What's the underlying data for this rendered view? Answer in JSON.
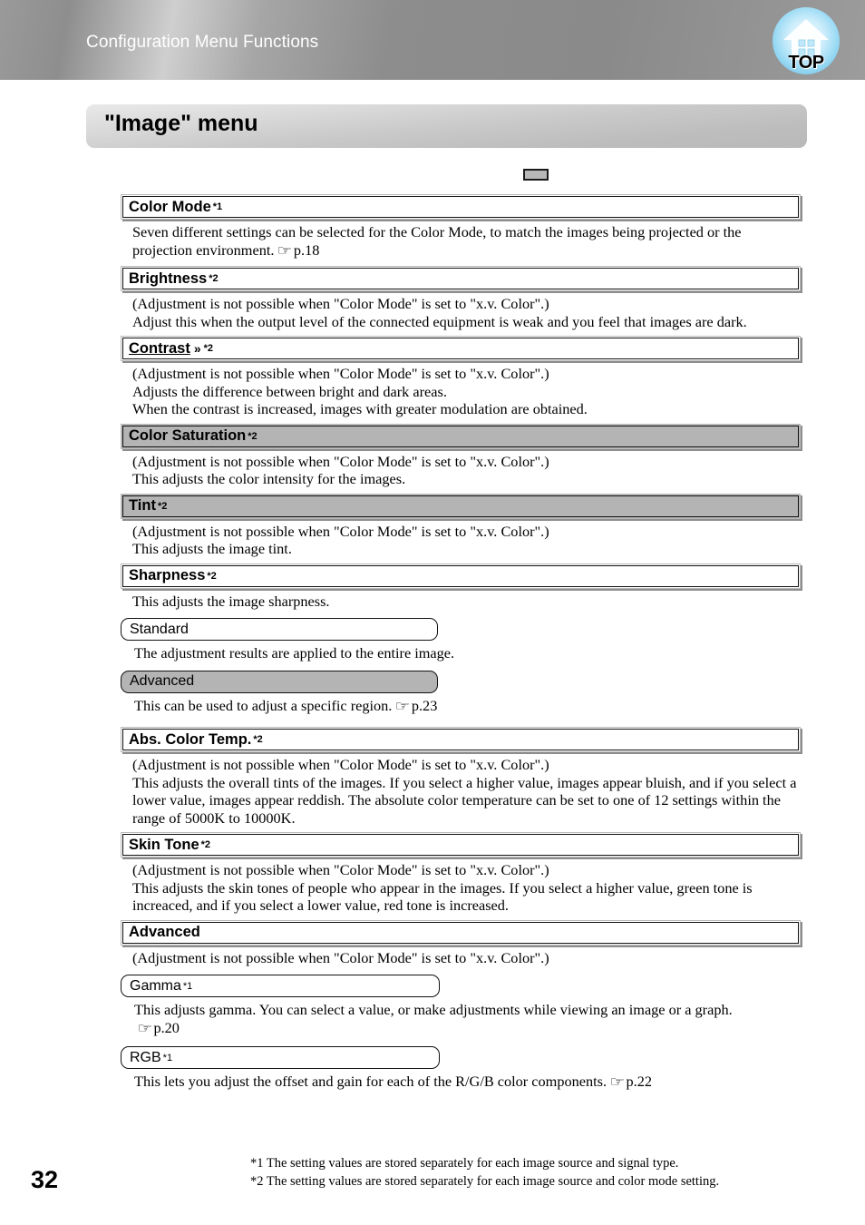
{
  "banner": {
    "title": "Configuration Menu Functions",
    "badge_label": "TOP",
    "badge_icon": "house-icon"
  },
  "page_title": "\"Image\" menu",
  "page_number": "32",
  "legend_chip": {
    "icon": "gray-swatch"
  },
  "sections": [
    {
      "id": "color-mode",
      "label": "Color Mode",
      "sup": "*1",
      "gloss": "",
      "underline": false,
      "filled": false,
      "paragraphs": [
        "Seven different settings can be selected for the Color Mode, to match the images being projected or the projection environment.",
        "p.18"
      ]
    },
    {
      "id": "brightness",
      "label": "Brightness",
      "sup": "*2",
      "gloss": "",
      "underline": false,
      "filled": false,
      "paragraphs": [
        "(Adjustment is not possible when \"Color Mode\" is set to \"x.v. Color\".)",
        "Adjust this when the output level of the connected equipment is weak and you feel that images are dark."
      ]
    },
    {
      "id": "contrast",
      "label": "Contrast",
      "sup": "*2",
      "gloss": "»",
      "underline": true,
      "filled": false,
      "paragraphs": [
        "(Adjustment is not possible when \"Color Mode\" is set to \"x.v. Color\".)",
        "Adjusts the difference between bright and dark areas.",
        "When the contrast is increased, images with greater modulation are obtained."
      ]
    },
    {
      "id": "color-saturation",
      "label": "Color Saturation",
      "sup": "*2",
      "gloss": "",
      "underline": false,
      "filled": true,
      "paragraphs": [
        "(Adjustment is not possible when \"Color Mode\" is set to \"x.v. Color\".)",
        "This adjusts the color intensity for the images."
      ]
    },
    {
      "id": "tint",
      "label": "Tint",
      "sup": "*2",
      "gloss": "",
      "underline": false,
      "filled": true,
      "paragraphs": [
        "(Adjustment is not possible when \"Color Mode\" is set to \"x.v. Color\".)",
        "This adjusts the image tint."
      ]
    },
    {
      "id": "sharpness",
      "label": "Sharpness",
      "sup": "*2",
      "gloss": "",
      "underline": false,
      "filled": false,
      "paragraphs": [
        "This adjusts the image sharpness."
      ],
      "subitems": [
        {
          "id": "standard",
          "label": "Standard",
          "sup": "",
          "filled": false,
          "text": "The adjustment results are applied to the entire image.",
          "ref": ""
        },
        {
          "id": "advanced-sharpness",
          "label": "Advanced",
          "sup": "",
          "filled": true,
          "text": "This can be used to adjust a specific region.",
          "ref": "p.23"
        }
      ]
    },
    {
      "id": "abs-color-temp",
      "label": "Abs. Color Temp.",
      "sup": "*2",
      "gloss": "",
      "underline": false,
      "filled": false,
      "paragraphs": [
        "(Adjustment is not possible when \"Color Mode\" is set to \"x.v. Color\".)",
        "This adjusts the overall tints of the images. If you select a higher value, images appear bluish, and if you select a lower value, images appear reddish. The absolute color temperature can be set to one of 12 settings within the range of 5000K to 10000K."
      ]
    },
    {
      "id": "skin-tone",
      "label": "Skin Tone",
      "sup": "*2",
      "gloss": "",
      "underline": false,
      "filled": false,
      "paragraphs": [
        "(Adjustment is not possible when \"Color Mode\" is set to \"x.v. Color\".)",
        "This adjusts the skin tones of people who appear in the images. If you select a higher value, green tone is increaced, and if you select a lower value, red tone is increased."
      ]
    },
    {
      "id": "advanced",
      "label": "Advanced",
      "sup": "",
      "gloss": "",
      "underline": false,
      "filled": false,
      "paragraphs": [
        "(Adjustment is not possible when \"Color Mode\" is set to \"x.v. Color\".)"
      ],
      "subitems": [
        {
          "id": "gamma",
          "label": "Gamma",
          "sup": "*1",
          "filled": false,
          "text": "This adjusts gamma. You can select a value, or make adjustments while viewing an image or a graph.",
          "ref": "p.20",
          "ref_newline": true
        },
        {
          "id": "rgb",
          "label": "RGB",
          "sup": "*1",
          "filled": false,
          "text": "This lets you adjust the offset and gain for each of the R/G/B color components.",
          "ref": "p.22"
        }
      ]
    }
  ],
  "footnotes": [
    "*1 The setting values are stored separately for each image source and signal type.",
    "*2 The setting values are stored separately for each image source and color mode setting."
  ]
}
